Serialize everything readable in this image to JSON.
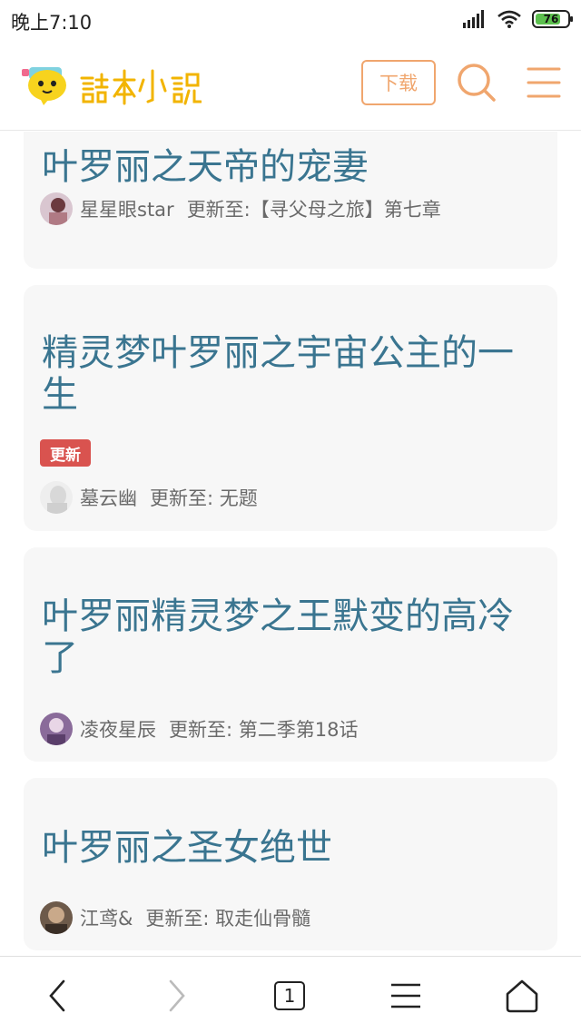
{
  "status_bar": {
    "time": "晚上7:10",
    "battery": "76"
  },
  "header": {
    "download_label": "下载"
  },
  "stories": [
    {
      "title": "叶罗丽之天帝的宠妻",
      "author": "星星眼star",
      "update": "更新至:【寻父母之旅】第七章"
    },
    {
      "title": "精灵梦叶罗丽之宇宙公主的一生",
      "badge": "更新",
      "author": "墓云幽",
      "update": "更新至: 无题"
    },
    {
      "title": "叶罗丽精灵梦之王默变的高冷了",
      "author": "凌夜星辰",
      "update": "更新至: 第二季第18话"
    },
    {
      "title": "叶罗丽之圣女绝世",
      "author": "江鸢&",
      "update": "更新至: 取走仙骨髓"
    }
  ],
  "bottom_nav": {
    "tab_count": "1"
  },
  "colors": {
    "accent": "#f0a66e",
    "title": "#3a7590",
    "badge": "#d9534f"
  }
}
